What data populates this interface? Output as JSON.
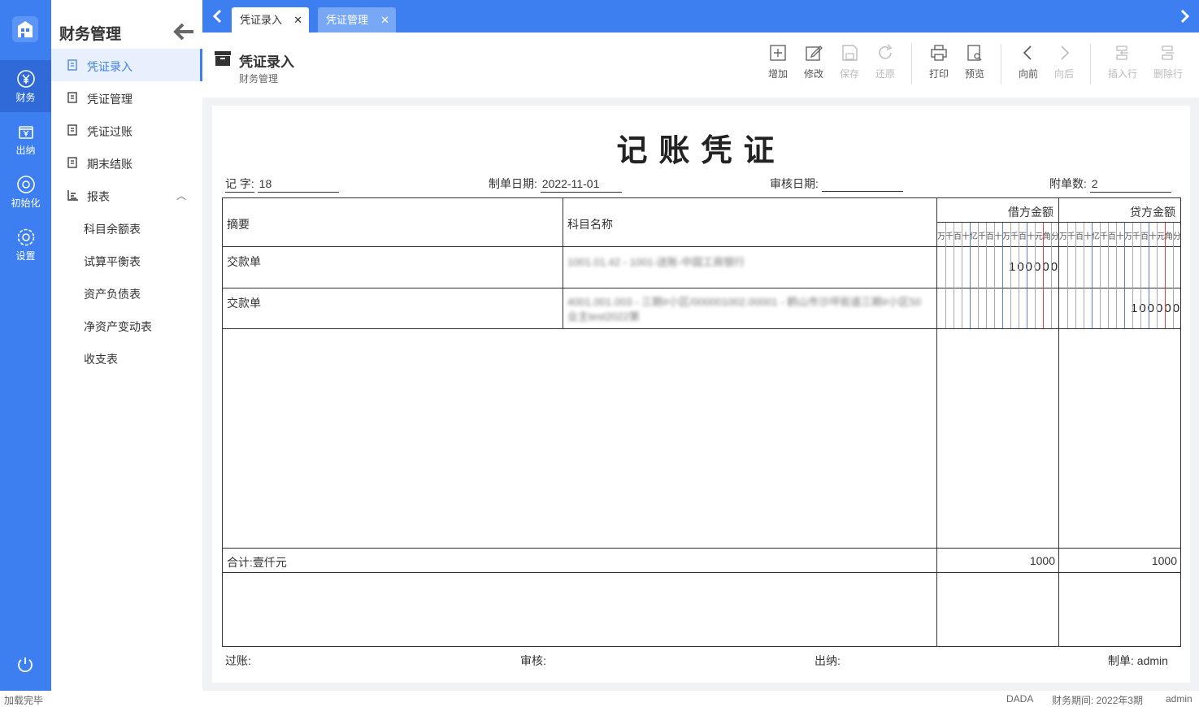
{
  "rail": {
    "items": [
      {
        "label": "财务",
        "icon": "yuan-circle-icon"
      },
      {
        "label": "出纳",
        "icon": "cashier-icon"
      },
      {
        "label": "初始化",
        "icon": "init-icon"
      },
      {
        "label": "设置",
        "icon": "gear-icon"
      }
    ]
  },
  "sidebar": {
    "title": "财务管理",
    "items": [
      {
        "label": "凭证录入"
      },
      {
        "label": "凭证管理"
      },
      {
        "label": "凭证过账"
      },
      {
        "label": "期末结账"
      },
      {
        "label": "报表"
      },
      {
        "label": "科目余额表"
      },
      {
        "label": "试算平衡表"
      },
      {
        "label": "资产负债表"
      },
      {
        "label": "净资产变动表"
      },
      {
        "label": "收支表"
      }
    ]
  },
  "tabs": [
    {
      "label": "凭证录入"
    },
    {
      "label": "凭证管理"
    }
  ],
  "header": {
    "title": "凭证录入",
    "subtitle": "财务管理"
  },
  "toolbar": {
    "add": "增加",
    "edit": "修改",
    "save": "保存",
    "restore": "还原",
    "print": "打印",
    "preview": "预览",
    "forward": "向前",
    "backward": "向后",
    "insert_row": "插入行",
    "delete_row": "删除行"
  },
  "voucher": {
    "title": "记账凭证",
    "word_label": "记 字:",
    "word_value": "18",
    "date_label": "制单日期:",
    "date_value": "2022-11-01",
    "audit_date_label": "审核日期:",
    "attach_label": "附单数:",
    "attach_value": "2",
    "col_summary": "摘要",
    "col_account": "科目名称",
    "col_debit": "借方金额",
    "col_credit": "贷方金额",
    "units": [
      "万",
      "千",
      "百",
      "十",
      "亿",
      "千",
      "百",
      "十",
      "万",
      "千",
      "百",
      "十",
      "元",
      "角",
      "分"
    ],
    "rows": [
      {
        "summary": "交款单",
        "account": "1001.01.42 - 1001-送账-中国工商银行",
        "debit": "100000",
        "credit": ""
      },
      {
        "summary": "交款单",
        "account": "4001.001.003 - 三期#小区/000001002.00001 - 鹤山市沙坪街道三期#小区50业主test2022第",
        "debit": "",
        "credit": "100000"
      }
    ],
    "total_label": "合计:",
    "total_text": "壹仟元",
    "total_debit": "1000",
    "total_credit": "1000",
    "posting_label": "过账:",
    "audit_label": "审核:",
    "cashier_label": "出纳:",
    "maker_label": "制单:",
    "maker_value": "admin"
  },
  "status": {
    "left": "加载完毕",
    "company": "DADA",
    "period": "财务期间: 2022年3期",
    "user": "admin"
  },
  "colors": {
    "primary": "#3d7ff0",
    "rail_active": "#2f6ad8"
  }
}
